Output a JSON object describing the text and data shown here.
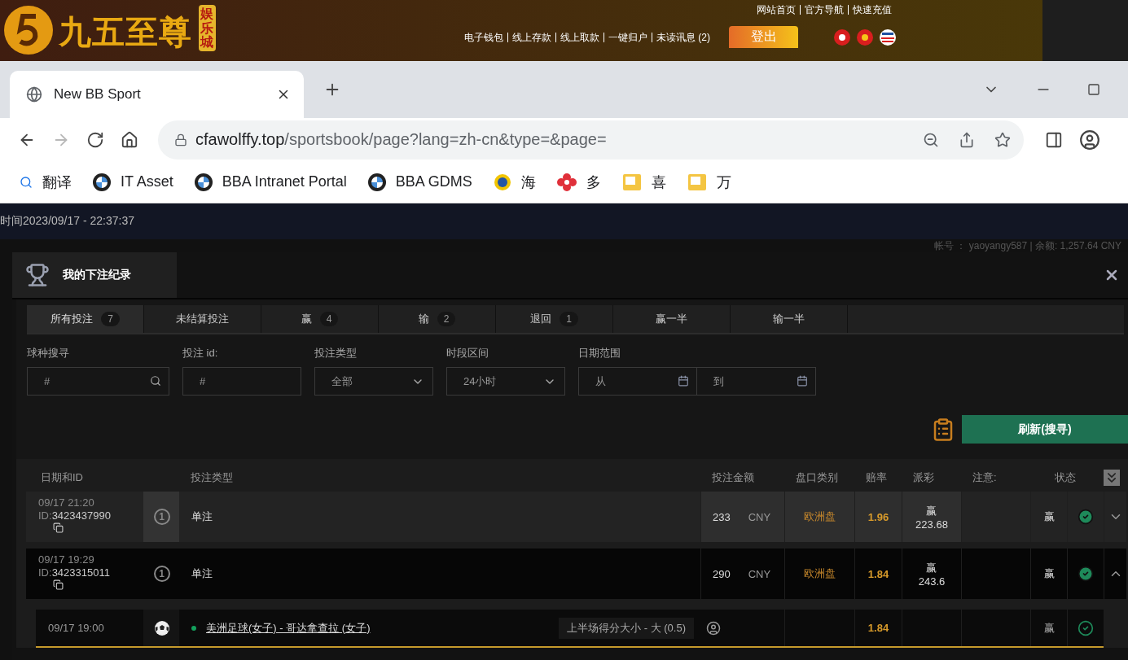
{
  "site": {
    "logo_text": "九五至尊",
    "logo_badge": "娱乐城",
    "top_links": [
      "网站首页",
      "官方导航",
      "快速充值"
    ],
    "nav_links": [
      "电子钱包",
      "线上存款",
      "线上取款",
      "一键归户",
      "未读讯息 (2)"
    ],
    "logout": "登出"
  },
  "browser": {
    "tab_title": "New BB Sport",
    "url_host": "cfawolffy.top",
    "url_path": "/sportsbook/page?lang=zh-cn&type=&page=",
    "nav_buttons": [
      {
        "kind": "back",
        "disabled": false
      },
      {
        "kind": "forward",
        "disabled": true
      },
      {
        "kind": "reload",
        "disabled": false
      },
      {
        "kind": "home",
        "disabled": false
      }
    ],
    "bookmarks": [
      {
        "kind": "search",
        "label": "翻译"
      },
      {
        "kind": "roundel",
        "label": "IT Asset"
      },
      {
        "kind": "roundel",
        "label": "BBA Intranet Portal"
      },
      {
        "kind": "roundel",
        "label": "BBA GDMS"
      },
      {
        "kind": "badge",
        "label": "海"
      },
      {
        "kind": "flower",
        "label": "多"
      },
      {
        "kind": "note",
        "label": "喜"
      },
      {
        "kind": "note",
        "label": "万"
      }
    ]
  },
  "page": {
    "clock": "时间2023/09/17 - 22:37:37",
    "account": "帐号 ： yaoyangy587 | 余额: 1,257.64 CNY"
  },
  "modal": {
    "title": "我的下注纪录",
    "tabs": [
      {
        "label": "所有投注",
        "count": "7",
        "selected": true
      },
      {
        "label": "未结算投注",
        "selected": false
      },
      {
        "label": "赢",
        "count": "4",
        "selected": false
      },
      {
        "label": "输",
        "count": "2",
        "selected": false
      },
      {
        "label": "退回",
        "count": "1",
        "selected": false
      },
      {
        "label": "赢一半",
        "selected": false
      },
      {
        "label": "输一半",
        "selected": false
      }
    ],
    "filters": [
      {
        "kind": "search",
        "label": "球种搜寻",
        "placeholder": "#"
      },
      {
        "kind": "text",
        "label": "投注 id:",
        "placeholder": "#"
      },
      {
        "kind": "select",
        "label": "投注类型",
        "value": "全部"
      },
      {
        "kind": "select",
        "label": "时段区间",
        "value": "24小时"
      },
      {
        "kind": "daterange",
        "label": "日期范围",
        "fields": [
          {
            "placeholder": "从"
          },
          {
            "placeholder": "到"
          }
        ]
      }
    ],
    "refresh": "刷新(搜寻)",
    "columns": [
      "日期和ID",
      "投注类型",
      "投注金额",
      "盘口类别",
      "赔率",
      "派彩",
      "注意:",
      "状态"
    ],
    "rows": [
      {
        "date": "09/17 21:20",
        "id_prefix": "ID:",
        "id": "3423437990",
        "legs_count": "1",
        "type": "单注",
        "amount": "233",
        "currency": "CNY",
        "market": "欧洲盘",
        "odds": "1.96",
        "payout_label": "赢",
        "payout": "223.68",
        "status": "赢",
        "highlighted": true,
        "expanded": false,
        "legs": []
      },
      {
        "date": "09/17 19:29",
        "id_prefix": "ID:",
        "id": "3423315011",
        "legs_count": "1",
        "type": "单注",
        "amount": "290",
        "currency": "CNY",
        "market": "欧洲盘",
        "odds": "1.84",
        "payout_label": "赢",
        "payout": "243.6",
        "status": "赢",
        "highlighted": false,
        "expanded": true,
        "legs": [
          {
            "date": "09/17 19:00",
            "match": "美洲足球(女子) - 哥达拿查拉 (女子)",
            "pick": "上半场得分大小 - 大 (0.5)",
            "odds": "1.84",
            "status": "赢"
          }
        ]
      }
    ]
  }
}
